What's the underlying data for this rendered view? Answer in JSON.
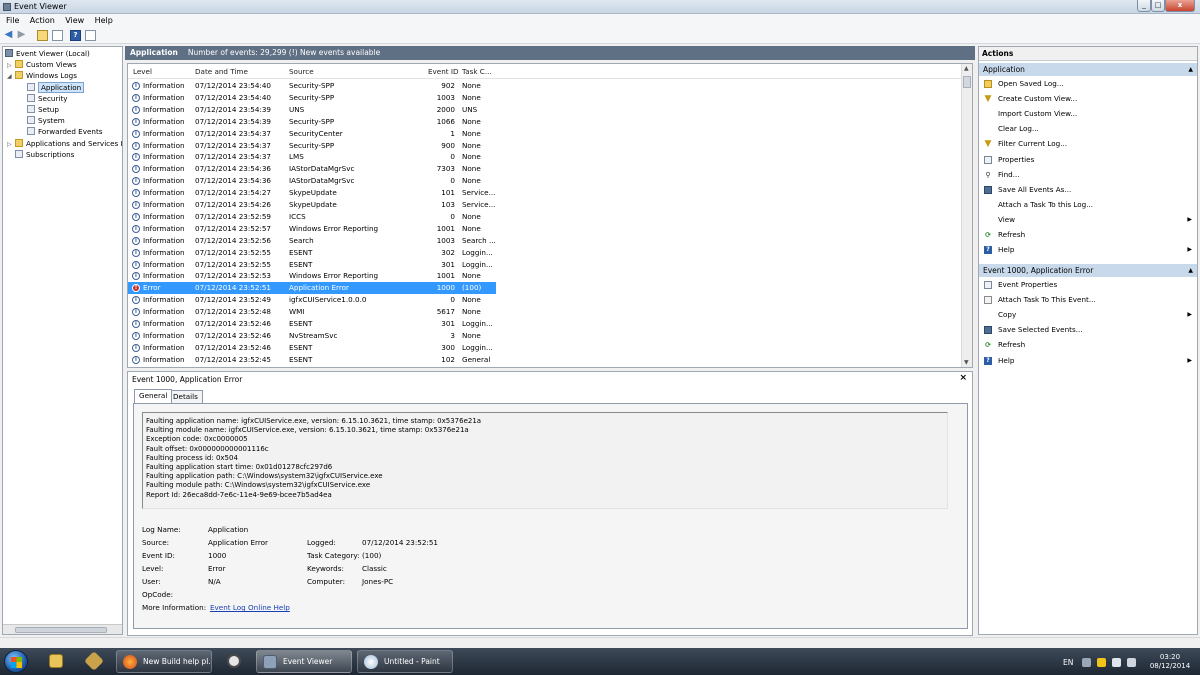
{
  "window": {
    "title": "Event Viewer",
    "close_glyph": "x",
    "min_glyph": "_",
    "max_glyph": "□"
  },
  "menu": [
    "File",
    "Action",
    "View",
    "Help"
  ],
  "tree": {
    "root": "Event Viewer (Local)",
    "custom_views": "Custom Views",
    "windows_logs": "Windows Logs",
    "logs": [
      "Application",
      "Security",
      "Setup",
      "System",
      "Forwarded Events"
    ],
    "apps_services": "Applications and Services Lo",
    "subscriptions": "Subscriptions"
  },
  "header": {
    "log_name": "Application",
    "summary": "Number of events: 29,299 (!) New events available"
  },
  "columns": {
    "level": "Level",
    "datetime": "Date and Time",
    "source": "Source",
    "event_id": "Event ID",
    "task": "Task C..."
  },
  "events": [
    {
      "level": "Information",
      "datetime": "07/12/2014 23:54:40",
      "source": "Security-SPP",
      "id": "902",
      "task": "None"
    },
    {
      "level": "Information",
      "datetime": "07/12/2014 23:54:40",
      "source": "Security-SPP",
      "id": "1003",
      "task": "None"
    },
    {
      "level": "Information",
      "datetime": "07/12/2014 23:54:39",
      "source": "UNS",
      "id": "2000",
      "task": "UNS"
    },
    {
      "level": "Information",
      "datetime": "07/12/2014 23:54:39",
      "source": "Security-SPP",
      "id": "1066",
      "task": "None"
    },
    {
      "level": "Information",
      "datetime": "07/12/2014 23:54:37",
      "source": "SecurityCenter",
      "id": "1",
      "task": "None"
    },
    {
      "level": "Information",
      "datetime": "07/12/2014 23:54:37",
      "source": "Security-SPP",
      "id": "900",
      "task": "None"
    },
    {
      "level": "Information",
      "datetime": "07/12/2014 23:54:37",
      "source": "LMS",
      "id": "0",
      "task": "None"
    },
    {
      "level": "Information",
      "datetime": "07/12/2014 23:54:36",
      "source": "IAStorDataMgrSvc",
      "id": "7303",
      "task": "None"
    },
    {
      "level": "Information",
      "datetime": "07/12/2014 23:54:36",
      "source": "IAStorDataMgrSvc",
      "id": "0",
      "task": "None"
    },
    {
      "level": "Information",
      "datetime": "07/12/2014 23:54:27",
      "source": "SkypeUpdate",
      "id": "101",
      "task": "Service..."
    },
    {
      "level": "Information",
      "datetime": "07/12/2014 23:54:26",
      "source": "SkypeUpdate",
      "id": "103",
      "task": "Service..."
    },
    {
      "level": "Information",
      "datetime": "07/12/2014 23:52:59",
      "source": "ICCS",
      "id": "0",
      "task": "None"
    },
    {
      "level": "Information",
      "datetime": "07/12/2014 23:52:57",
      "source": "Windows Error Reporting",
      "id": "1001",
      "task": "None"
    },
    {
      "level": "Information",
      "datetime": "07/12/2014 23:52:56",
      "source": "Search",
      "id": "1003",
      "task": "Search ..."
    },
    {
      "level": "Information",
      "datetime": "07/12/2014 23:52:55",
      "source": "ESENT",
      "id": "302",
      "task": "Loggin..."
    },
    {
      "level": "Information",
      "datetime": "07/12/2014 23:52:55",
      "source": "ESENT",
      "id": "301",
      "task": "Loggin..."
    },
    {
      "level": "Information",
      "datetime": "07/12/2014 23:52:53",
      "source": "Windows Error Reporting",
      "id": "1001",
      "task": "None"
    },
    {
      "level": "Error",
      "datetime": "07/12/2014 23:52:51",
      "source": "Application Error",
      "id": "1000",
      "task": "(100)"
    },
    {
      "level": "Information",
      "datetime": "07/12/2014 23:52:49",
      "source": "igfxCUIService1.0.0.0",
      "id": "0",
      "task": "None"
    },
    {
      "level": "Information",
      "datetime": "07/12/2014 23:52:48",
      "source": "WMI",
      "id": "5617",
      "task": "None"
    },
    {
      "level": "Information",
      "datetime": "07/12/2014 23:52:46",
      "source": "ESENT",
      "id": "301",
      "task": "Loggin..."
    },
    {
      "level": "Information",
      "datetime": "07/12/2014 23:52:46",
      "source": "NvStreamSvc",
      "id": "3",
      "task": "None"
    },
    {
      "level": "Information",
      "datetime": "07/12/2014 23:52:46",
      "source": "ESENT",
      "id": "300",
      "task": "Loggin..."
    },
    {
      "level": "Information",
      "datetime": "07/12/2014 23:52:45",
      "source": "ESENT",
      "id": "102",
      "task": "General"
    }
  ],
  "detail": {
    "title": "Event 1000, Application Error",
    "close": "×",
    "tabs": [
      "General",
      "Details"
    ],
    "description": [
      "Faulting application name: igfxCUIService.exe, version: 6.15.10.3621, time stamp: 0x5376e21a",
      "Faulting module name: igfxCUIService.exe, version: 6.15.10.3621, time stamp: 0x5376e21a",
      "Exception code: 0xc0000005",
      "Fault offset: 0x000000000001116c",
      "Faulting process id: 0x504",
      "Faulting application start time: 0x01d01278cfc297d6",
      "Faulting application path: C:\\Windows\\system32\\igfxCUIService.exe",
      "Faulting module path: C:\\Windows\\system32\\igfxCUIService.exe",
      "Report Id: 26eca8dd-7e6c-11e4-9e69-bcee7b5ad4ea"
    ],
    "labels": {
      "log_name": "Log Name:",
      "source": "Source:",
      "event_id": "Event ID:",
      "level": "Level:",
      "user": "User:",
      "opcode": "OpCode:",
      "more_info": "More Information:",
      "logged": "Logged:",
      "task_category": "Task Category:",
      "keywords": "Keywords:",
      "computer": "Computer:"
    },
    "values": {
      "log_name": "Application",
      "source": "Application Error",
      "event_id": "1000",
      "level": "Error",
      "user": "N/A",
      "logged": "07/12/2014 23:52:51",
      "task_category": "(100)",
      "keywords": "Classic",
      "computer": "Jones-PC",
      "more_info_link": "Event Log Online Help"
    }
  },
  "actions": {
    "title": "Actions",
    "section1": "Application",
    "section1_items": [
      "Open Saved Log...",
      "Create Custom View...",
      "Import Custom View...",
      "Clear Log...",
      "Filter Current Log...",
      "Properties",
      "Find...",
      "Save All Events As...",
      "Attach a Task To this Log...",
      "View",
      "Refresh",
      "Help"
    ],
    "section2": "Event 1000, Application Error",
    "section2_items": [
      "Event Properties",
      "Attach Task To This Event...",
      "Copy",
      "Save Selected Events...",
      "Refresh",
      "Help"
    ]
  },
  "taskbar": {
    "items": [
      "New Build help pl...",
      "Event Viewer",
      "Untitled - Paint"
    ],
    "lang": "EN",
    "time": "03:20",
    "date": "08/12/2014"
  },
  "colors": {
    "selection": "#3399ff",
    "header_bar": "#5f6f84",
    "actions_section": "#c9d9ec"
  }
}
